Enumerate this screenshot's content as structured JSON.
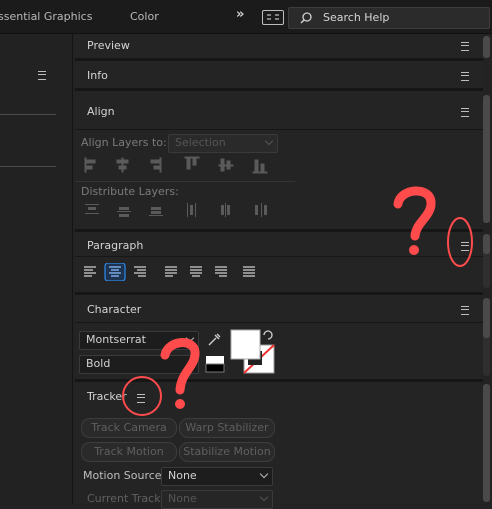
{
  "topbar": {
    "tabs": [
      "ssential Graphics",
      "Color"
    ],
    "search_label": "Search Help",
    "icons": [
      "double-chevron-icon",
      "workspace-switch-icon",
      "search-icon"
    ]
  },
  "panels": {
    "preview": {
      "title": "Preview"
    },
    "info": {
      "title": "Info"
    },
    "align": {
      "title": "Align",
      "align_to_label": "Align Layers to:",
      "align_to_value": "Selection",
      "distribute_label": "Distribute Layers:"
    },
    "paragraph": {
      "title": "Paragraph"
    },
    "character": {
      "title": "Character",
      "font_family": "Montserrat",
      "font_style": "Bold"
    },
    "tracker": {
      "title": "Tracker",
      "buttons": [
        "Track Camera",
        "Warp Stabilizer",
        "Track Motion",
        "Stabilize Motion"
      ],
      "motion_source_label": "Motion Source:",
      "motion_source_value": "None",
      "current_track_label": "Current Track:",
      "current_track_value": "None"
    }
  },
  "colors": {
    "background": "#232323",
    "annotation_red": "#ff4b4b",
    "active_button": "#2d8ceb"
  }
}
